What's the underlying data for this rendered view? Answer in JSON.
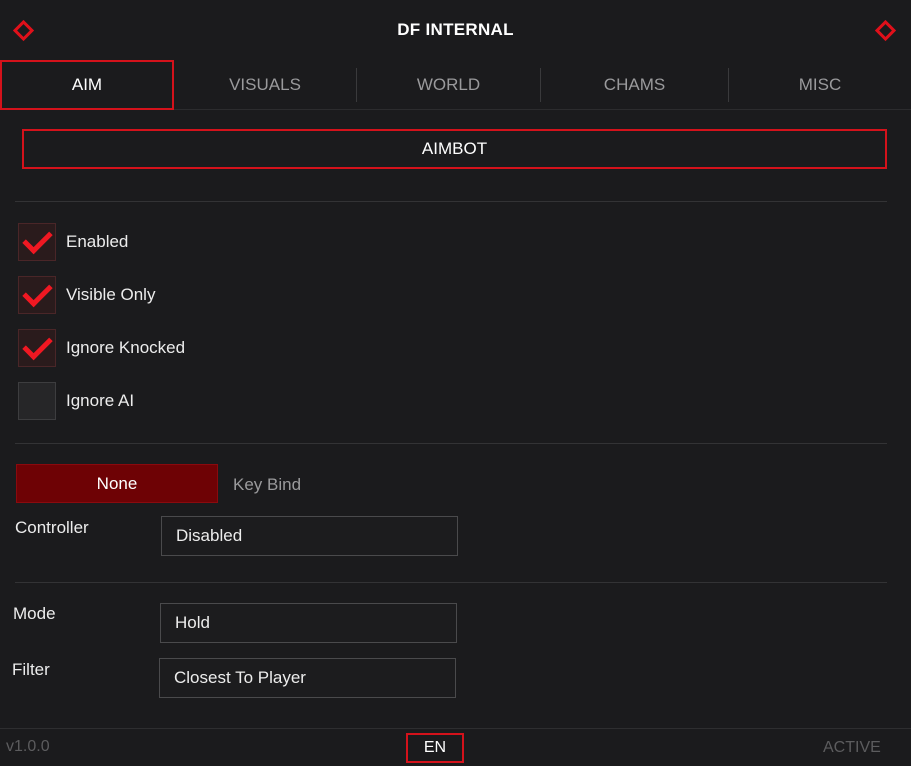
{
  "window": {
    "title": "DF INTERNAL"
  },
  "tabs": [
    {
      "label": "AIM",
      "active": true
    },
    {
      "label": "VISUALS",
      "active": false
    },
    {
      "label": "WORLD",
      "active": false
    },
    {
      "label": "CHAMS",
      "active": false
    },
    {
      "label": "MISC",
      "active": false
    }
  ],
  "section": {
    "title": "AIMBOT"
  },
  "checkboxes": [
    {
      "label": "Enabled",
      "checked": true
    },
    {
      "label": "Visible Only",
      "checked": true
    },
    {
      "label": "Ignore Knocked",
      "checked": true
    },
    {
      "label": "Ignore AI",
      "checked": false
    }
  ],
  "keybind": {
    "value": "None",
    "label": "Key Bind"
  },
  "fields": {
    "controller": {
      "label": "Controller",
      "value": "Disabled"
    },
    "mode": {
      "label": "Mode",
      "value": "Hold"
    },
    "filter": {
      "label": "Filter",
      "value": "Closest To Player"
    }
  },
  "footer": {
    "version": "v1.0.0",
    "language": "EN",
    "status": "ACTIVE"
  },
  "colors": {
    "accent": "#d4121b",
    "background": "#1b1b1d",
    "keybind_fill": "#6e0205"
  },
  "icons": {
    "corner": "diamond-icon",
    "check": "check-icon"
  }
}
